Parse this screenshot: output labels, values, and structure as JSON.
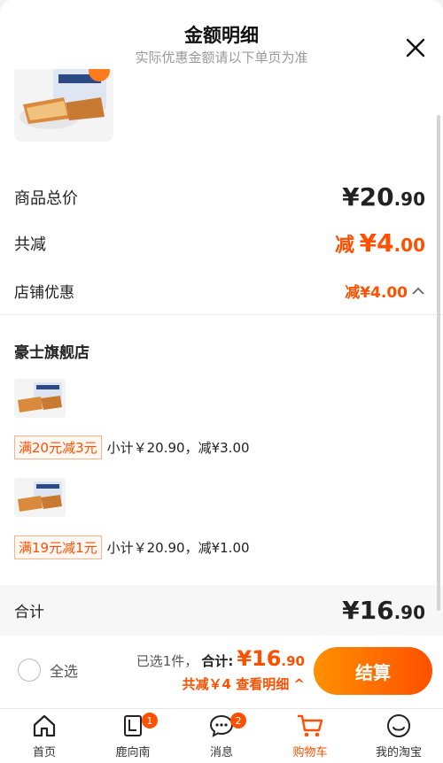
{
  "header": {
    "title": "金额明细",
    "subtitle": "实际优惠金额请以下单页为准"
  },
  "summary": {
    "goods_total_label": "商品总价",
    "goods_total_yuan": "¥20",
    "goods_total_cents": ".90",
    "reduce_label": "共减",
    "reduce_value_prefix": "减",
    "reduce_value_yuan": "¥4",
    "reduce_value_cents": ".00",
    "shop_discount_label": "店铺优惠",
    "shop_discount_value": "减¥4.00"
  },
  "shop": {
    "name": "豪士旗舰店",
    "items": [
      {
        "promo_tag": "满20元减3元",
        "subtotal": "小计￥20.90，减¥3.00"
      },
      {
        "promo_tag": "满19元减1元",
        "subtotal": "小计￥20.90，减¥1.00"
      }
    ]
  },
  "total": {
    "label": "合计",
    "yuan": "¥16",
    "cents": ".90"
  },
  "checkout": {
    "select_all": "全选",
    "selected_count": "已选1件，",
    "total_label": "合计:",
    "total_yuan": "¥16",
    "total_cents": ".90",
    "discount_detail": "共减￥4 查看明细 ^",
    "settle_button": "结算"
  },
  "tabbar": [
    {
      "label": "首页",
      "icon": "home-icon"
    },
    {
      "label": "鹿向南",
      "icon": "brand-logo-icon",
      "badge": "1"
    },
    {
      "label": "消息",
      "icon": "message-icon",
      "badge": "2"
    },
    {
      "label": "购物车",
      "icon": "cart-icon",
      "active": true
    },
    {
      "label": "我的淘宝",
      "icon": "profile-icon"
    }
  ],
  "colors": {
    "accent": "#ff5000",
    "accent_gradient_start": "#ff9000"
  }
}
